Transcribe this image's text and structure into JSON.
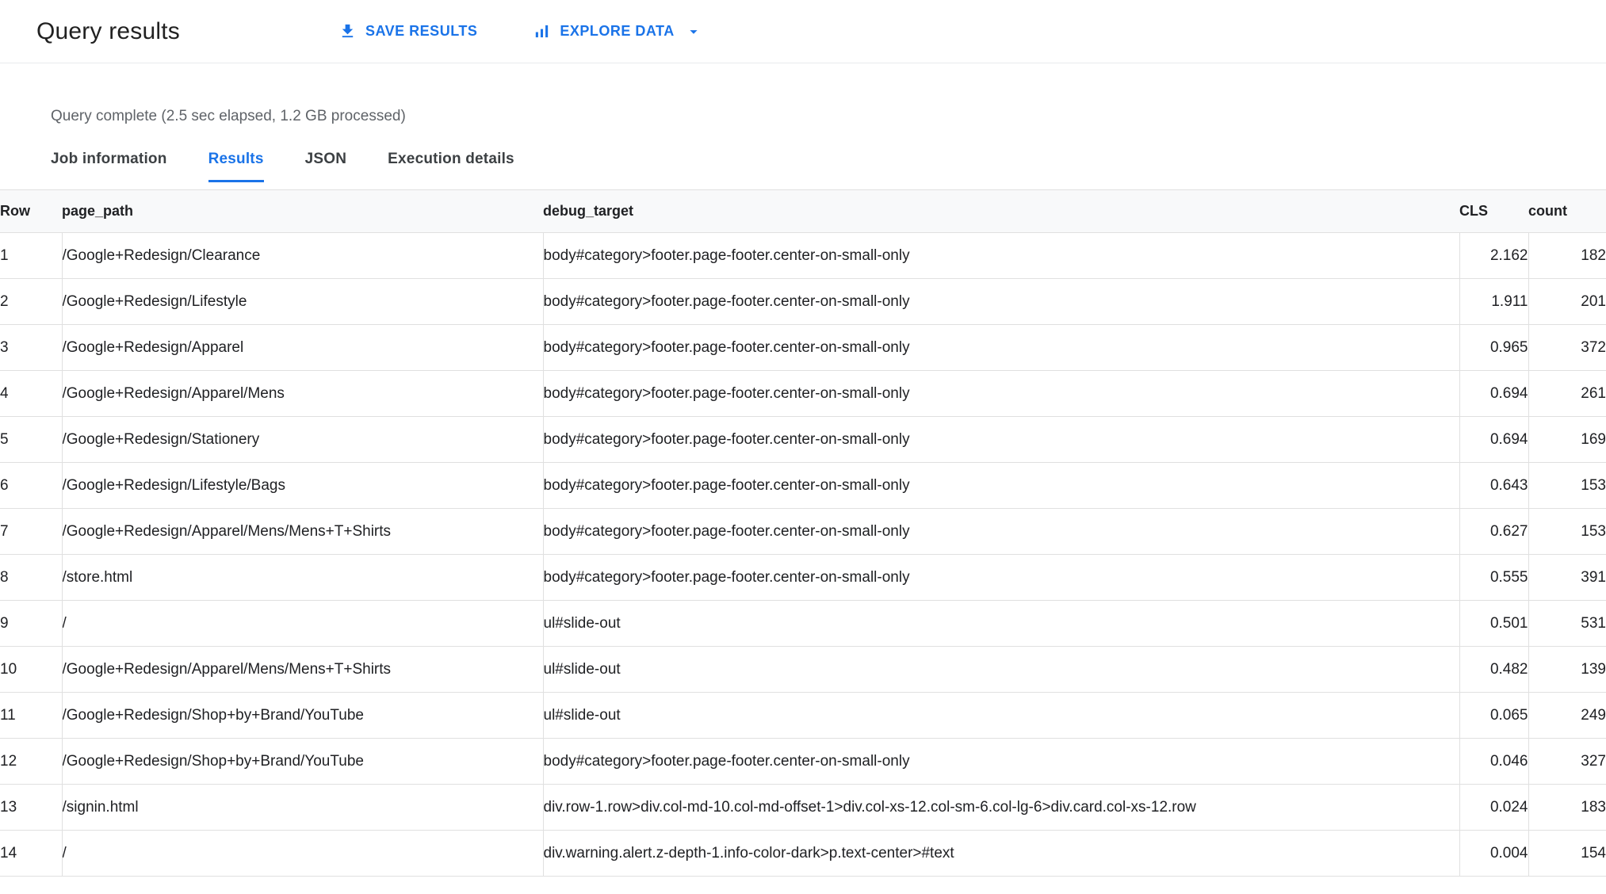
{
  "header": {
    "title": "Query results",
    "buttons": {
      "save": "SAVE RESULTS",
      "explore": "EXPLORE DATA"
    }
  },
  "status_text": "Query complete (2.5 sec elapsed, 1.2 GB processed)",
  "tabs": [
    {
      "label": "Job information",
      "active": false
    },
    {
      "label": "Results",
      "active": true
    },
    {
      "label": "JSON",
      "active": false
    },
    {
      "label": "Execution details",
      "active": false
    }
  ],
  "table": {
    "columns": {
      "row": "Row",
      "page_path": "page_path",
      "debug_target": "debug_target",
      "cls": "CLS",
      "count": "count"
    },
    "rows": [
      {
        "row": 1,
        "page_path": "/Google+Redesign/Clearance",
        "debug_target": "body#category>footer.page-footer.center-on-small-only",
        "cls": "2.162",
        "count": 182
      },
      {
        "row": 2,
        "page_path": "/Google+Redesign/Lifestyle",
        "debug_target": "body#category>footer.page-footer.center-on-small-only",
        "cls": "1.911",
        "count": 201
      },
      {
        "row": 3,
        "page_path": "/Google+Redesign/Apparel",
        "debug_target": "body#category>footer.page-footer.center-on-small-only",
        "cls": "0.965",
        "count": 372
      },
      {
        "row": 4,
        "page_path": "/Google+Redesign/Apparel/Mens",
        "debug_target": "body#category>footer.page-footer.center-on-small-only",
        "cls": "0.694",
        "count": 261
      },
      {
        "row": 5,
        "page_path": "/Google+Redesign/Stationery",
        "debug_target": "body#category>footer.page-footer.center-on-small-only",
        "cls": "0.694",
        "count": 169
      },
      {
        "row": 6,
        "page_path": "/Google+Redesign/Lifestyle/Bags",
        "debug_target": "body#category>footer.page-footer.center-on-small-only",
        "cls": "0.643",
        "count": 153
      },
      {
        "row": 7,
        "page_path": "/Google+Redesign/Apparel/Mens/Mens+T+Shirts",
        "debug_target": "body#category>footer.page-footer.center-on-small-only",
        "cls": "0.627",
        "count": 153
      },
      {
        "row": 8,
        "page_path": "/store.html",
        "debug_target": "body#category>footer.page-footer.center-on-small-only",
        "cls": "0.555",
        "count": 391
      },
      {
        "row": 9,
        "page_path": "/",
        "debug_target": "ul#slide-out",
        "cls": "0.501",
        "count": 531
      },
      {
        "row": 10,
        "page_path": "/Google+Redesign/Apparel/Mens/Mens+T+Shirts",
        "debug_target": "ul#slide-out",
        "cls": "0.482",
        "count": 139
      },
      {
        "row": 11,
        "page_path": "/Google+Redesign/Shop+by+Brand/YouTube",
        "debug_target": "ul#slide-out",
        "cls": "0.065",
        "count": 249
      },
      {
        "row": 12,
        "page_path": "/Google+Redesign/Shop+by+Brand/YouTube",
        "debug_target": "body#category>footer.page-footer.center-on-small-only",
        "cls": "0.046",
        "count": 327
      },
      {
        "row": 13,
        "page_path": "/signin.html",
        "debug_target": "div.row-1.row>div.col-md-10.col-md-offset-1>div.col-xs-12.col-sm-6.col-lg-6>div.card.col-xs-12.row",
        "cls": "0.024",
        "count": 183
      },
      {
        "row": 14,
        "page_path": "/",
        "debug_target": "div.warning.alert.z-depth-1.info-color-dark>p.text-center>#text",
        "cls": "0.004",
        "count": 154
      }
    ]
  },
  "colors": {
    "accent": "#1a73e8",
    "border": "#e0e0e0",
    "header_bg": "#f8f9fa",
    "text": "#202124",
    "muted": "#5f6368"
  }
}
